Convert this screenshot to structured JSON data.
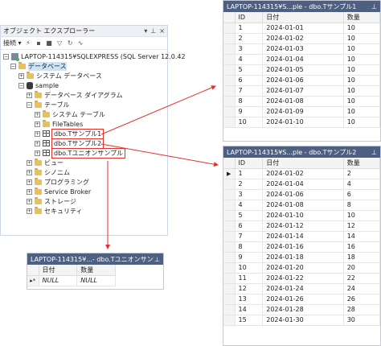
{
  "explorer": {
    "title": "オブジェクト エクスプローラー",
    "title_buttons": [
      "▾",
      "⊥",
      "×"
    ],
    "connect_label": "接続 ▾",
    "tree": {
      "server": "LAPTOP-114315¥SQLEXPRESS (SQL Server 12.0.42",
      "databases": "データベース",
      "system_databases": "システム データベース",
      "sample": "sample",
      "diagrams": "データベース ダイアグラム",
      "tables": "テーブル",
      "system_tables": "システム テーブル",
      "filetables": "FileTables",
      "table1": "dbo.Tサンプル1",
      "table2": "dbo.Tサンプル2",
      "table_union": "dbo.Tユニオンサンプル",
      "views": "ビュー",
      "synonyms": "シノニム",
      "programmability": "プログラミング",
      "service_broker": "Service Broker",
      "storage": "ストレージ",
      "security": "セキュリティ"
    }
  },
  "grid1": {
    "title": "LAPTOP-114315¥S...ple - dbo.Tサンプル1",
    "columns": [
      "ID",
      "日付",
      "数量"
    ],
    "rows": [
      [
        "1",
        "2024-01-01",
        "10"
      ],
      [
        "2",
        "2024-01-02",
        "10"
      ],
      [
        "3",
        "2024-01-03",
        "10"
      ],
      [
        "4",
        "2024-01-04",
        "10"
      ],
      [
        "5",
        "2024-01-05",
        "10"
      ],
      [
        "6",
        "2024-01-06",
        "10"
      ],
      [
        "7",
        "2024-01-07",
        "10"
      ],
      [
        "8",
        "2024-01-08",
        "10"
      ],
      [
        "9",
        "2024-01-09",
        "10"
      ],
      [
        "10",
        "2024-01-10",
        "10"
      ]
    ]
  },
  "grid2": {
    "title": "LAPTOP-114315¥S...ple - dbo.Tサンプル2",
    "columns": [
      "ID",
      "日付",
      "数量"
    ],
    "rows": [
      [
        "1",
        "2024-01-02",
        "2"
      ],
      [
        "2",
        "2024-01-04",
        "4"
      ],
      [
        "3",
        "2024-01-06",
        "6"
      ],
      [
        "4",
        "2024-01-08",
        "8"
      ],
      [
        "5",
        "2024-01-10",
        "10"
      ],
      [
        "6",
        "2024-01-12",
        "12"
      ],
      [
        "7",
        "2024-01-14",
        "14"
      ],
      [
        "8",
        "2024-01-16",
        "16"
      ],
      [
        "9",
        "2024-01-18",
        "18"
      ],
      [
        "10",
        "2024-01-20",
        "20"
      ],
      [
        "11",
        "2024-01-22",
        "22"
      ],
      [
        "12",
        "2024-01-24",
        "24"
      ],
      [
        "13",
        "2024-01-26",
        "26"
      ],
      [
        "14",
        "2024-01-28",
        "28"
      ],
      [
        "15",
        "2024-01-30",
        "30"
      ]
    ]
  },
  "grid3": {
    "title": "LAPTOP-114315¥...- dbo.Tユニオンサンプル",
    "columns": [
      "日付",
      "数量"
    ],
    "rows": [
      [
        "NULL",
        "NULL"
      ]
    ],
    "new_row_marker": "▸*"
  },
  "colors": {
    "title_bar": "#4d6082",
    "highlight_box": "#e0312d",
    "arrow": "#e0312d"
  }
}
